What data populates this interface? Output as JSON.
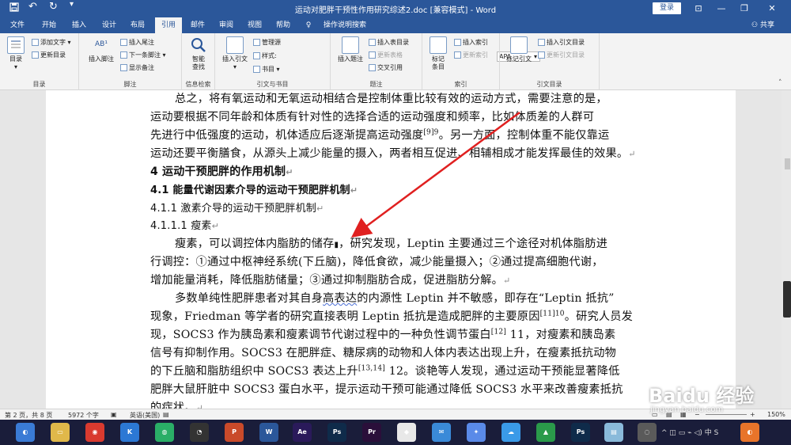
{
  "titlebar": {
    "title": "运动对肥胖干预性作用研究综述2.doc [兼容模式] - Word",
    "login": "登录",
    "save_icon": "save-icon",
    "undo": "↶",
    "redo": "↻",
    "min": "—",
    "restore": "❐",
    "close": "✕",
    "ribbon_opt": "⊡"
  },
  "tabs": [
    {
      "label": "文件"
    },
    {
      "label": "开始"
    },
    {
      "label": "插入"
    },
    {
      "label": "设计"
    },
    {
      "label": "布局"
    },
    {
      "label": "引用"
    },
    {
      "label": "邮件"
    },
    {
      "label": "审阅"
    },
    {
      "label": "视图"
    },
    {
      "label": "帮助"
    },
    {
      "label": "操作说明搜索"
    }
  ],
  "share": "共享",
  "ribbon": {
    "toc": {
      "btn": "目录",
      "add_text": "添加文字",
      "update": "更新目录",
      "label": "目录"
    },
    "footnote": {
      "btn": "插入脚注",
      "endnote": "插入尾注",
      "next": "下一条脚注",
      "show": "显示备注",
      "label": "脚注"
    },
    "research": {
      "btn1": "智能",
      "btn2": "查找",
      "label": "信息检索"
    },
    "citation": {
      "btn": "插入引文",
      "manage": "管理源",
      "style": "样式:",
      "style_value": "APA",
      "bib": "书目",
      "label": "引文与书目"
    },
    "caption": {
      "btn": "插入题注",
      "table_fig": "插入表目录",
      "update_tbl": "更新表格",
      "cross": "交叉引用",
      "label": "题注"
    },
    "index": {
      "btn1": "标记",
      "btn2": "条目",
      "insert": "插入索引",
      "update": "更新索引",
      "label": "索引"
    },
    "toa": {
      "btn": "标记引文",
      "insert": "插入引文目录",
      "update": "更新引文目录",
      "label": "引文目录"
    }
  },
  "document": {
    "lines": [
      "总之，将有氧运动和无氧运动相结合是控制体重比较有效的运动方式，需要注意的是，",
      "运动要根据不同年龄和体质有针对性的选择合适的运动强度和频率，比如体质差的人群可",
      "先进行中低强度的运动，机体适应后逐渐提高运动强度",
      "运动还要平衡膳食，从源头上减少能量的摄入，两者相互促进、相辅相成才能发挥最佳的效果。",
      "4  运动干预肥胖的作用机制",
      "4.1  能量代谢因素介导的运动干预肥胖机制",
      "4.1.1  激素介导的运动干预肥胖机制",
      "4.1.1.1  瘦素",
      "瘦素，可以调控体内脂肪的储存",
      "行调控：①通过中枢神经系统(下丘脑)，降低食欲，减少能量摄入；②通过提高细胞代谢，",
      "增加能量消耗，降低脂肪储量；③通过抑制脂肪合成，促进脂肪分解。",
      "多数单纯性肥胖患者对其自身",
      "现象，Friedman 等学者的研究直接表明 Leptin 抵抗是造成肥胖的主要原因",
      "现，SOCS3 作为胰岛素和瘦素调节代谢过程中的一种负性调节蛋白",
      "信号有抑制作用。SOCS3 在肥胖症、糖尿病的动物和人体内表达出现上升，在瘦素抵抗动物",
      "的下丘脑和脂肪组织中 SOCS3 表达上升",
      "肥胖大鼠肝脏中 SOCS3 蛋白水平，提示运动干预可能通过降低 SOCS3 水平来改善瘦素抵抗",
      "的症状。"
    ],
    "fragments": {
      "l3_ref": "[9]9",
      "l3_tail": "。另一方面，控制体重不能仅靠运",
      "l9_tail": "，研究发现，Leptin 主要通过三个途径对机体脂肪进",
      "l12_mid": "高表达",
      "l12_tail": "的内源性 Leptin 并不敏感，即存在“Leptin 抵抗”",
      "l13_ref": "[11]10",
      "l13_tail": "。研究人员发",
      "l14_ref": "[12]",
      "l14_tail": " 11，对瘦素和胰岛素",
      "l16_ref": "[13,14]",
      "l16_tail": " 12。谈艳等人发现，通过运动干预能显著降低",
      "para_mark": "↵"
    }
  },
  "statusbar": {
    "page": "第 2 页，共 8 页",
    "words": "5972 个字",
    "lang": "英语(美国)",
    "zoom": "150%",
    "minus": "−",
    "plus": "+"
  },
  "taskbar": {
    "apps": [
      {
        "name": "browser-icon",
        "label": "◐",
        "color": "#3a7bd5"
      },
      {
        "name": "file-explorer-icon",
        "label": "▭",
        "color": "#e0b84a"
      },
      {
        "name": "netease-music-icon",
        "label": "◉",
        "color": "#d93a2f"
      },
      {
        "name": "kugou-icon",
        "label": "K",
        "color": "#2c78d4"
      },
      {
        "name": "wechat-icon",
        "label": "◍",
        "color": "#2aae67"
      },
      {
        "name": "qq-icon",
        "label": "◔",
        "color": "#333333"
      },
      {
        "name": "powerpoint-icon",
        "label": "P",
        "color": "#c94a2a"
      },
      {
        "name": "word-icon",
        "label": "W",
        "color": "#2b579a"
      },
      {
        "name": "after-effects-icon",
        "label": "Ae",
        "color": "#2a1a5a"
      },
      {
        "name": "photoshop-icon",
        "label": "Ps",
        "color": "#0f2b4a"
      },
      {
        "name": "premiere-icon",
        "label": "Pr",
        "color": "#2a0f3a"
      },
      {
        "name": "security-icon",
        "label": "◆",
        "color": "#e8e8e8"
      },
      {
        "name": "mail-icon",
        "label": "✉",
        "color": "#3a8ad8"
      },
      {
        "name": "bird-icon",
        "label": "✦",
        "color": "#5a8ae8"
      },
      {
        "name": "cloud-icon",
        "label": "☁",
        "color": "#3a9ae8"
      },
      {
        "name": "green-app-icon",
        "label": "▲",
        "color": "#2a9a4a"
      },
      {
        "name": "photoshop-2-icon",
        "label": "Ps",
        "color": "#0f2b4a"
      },
      {
        "name": "notepad-icon",
        "label": "▤",
        "color": "#8abada"
      },
      {
        "name": "sync-icon",
        "label": "◌",
        "color": "#5a5a5a"
      },
      {
        "name": "orange-app-icon",
        "label": "◐",
        "color": "#e8742a"
      }
    ],
    "tray": "^  ◫  ▭  ⌁  ◁)  中  S"
  },
  "watermark": {
    "text": "Baidu 经验",
    "sub": "jingyan.baidu.com"
  }
}
